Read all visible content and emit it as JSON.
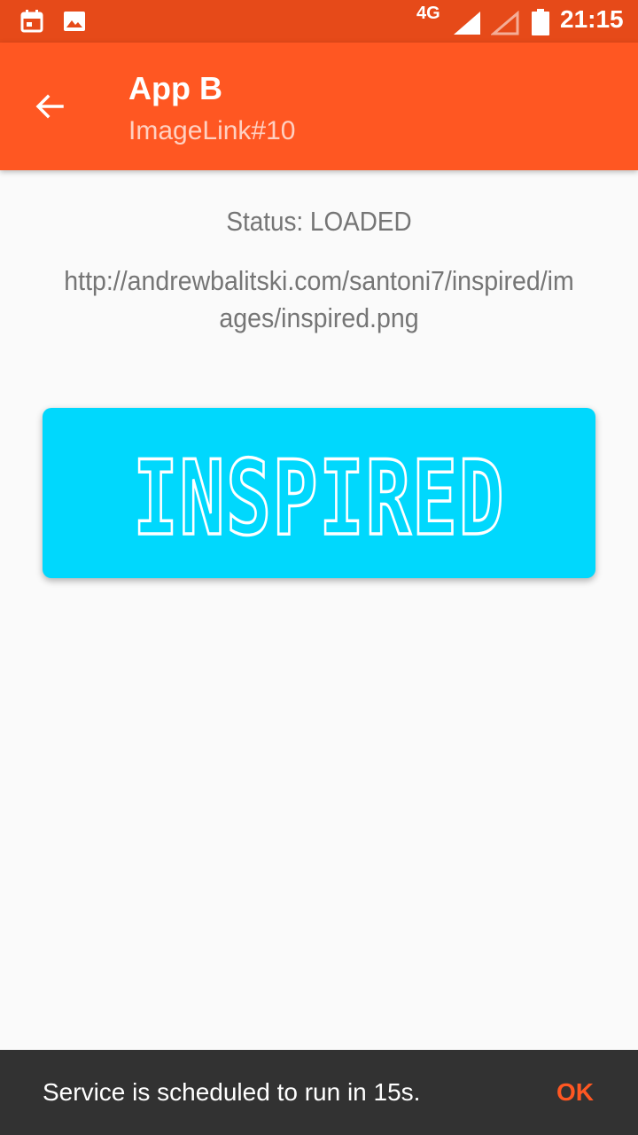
{
  "status_bar": {
    "network": "4G",
    "time": "21:15",
    "icons": [
      "calendar-icon",
      "image-icon",
      "signal-icon",
      "signal-empty-icon",
      "battery-icon"
    ]
  },
  "app_bar": {
    "title": "App B",
    "subtitle": "ImageLink#10",
    "back_icon": "arrow-back-icon"
  },
  "content": {
    "status": "Status: LOADED",
    "url": "http://andrewbalitski.com/santoni7/inspired/images/inspired.png",
    "image_text": "INSPIRED"
  },
  "snackbar": {
    "message": "Service is scheduled to run in 15s.",
    "action": "OK"
  },
  "colors": {
    "status_bar": "#e64a19",
    "app_bar": "#ff5722",
    "image_bg": "#00d8fd",
    "snackbar_bg": "#323232",
    "accent": "#ff5722"
  }
}
